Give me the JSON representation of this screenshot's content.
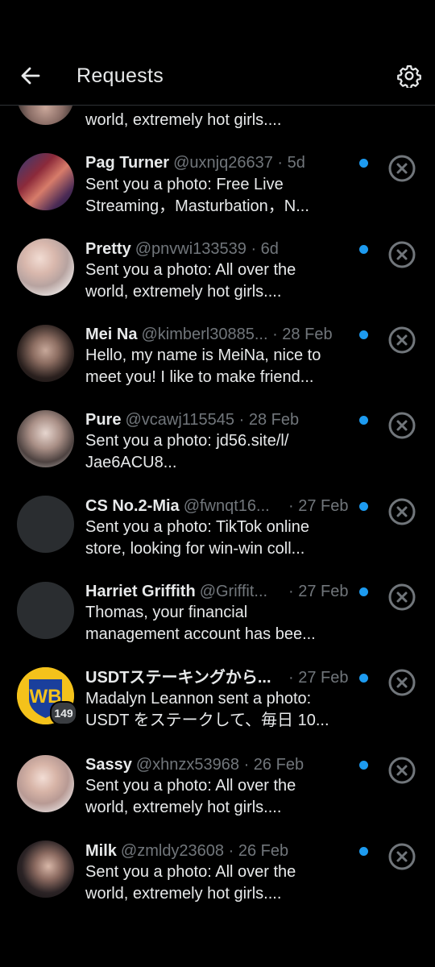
{
  "header": {
    "title": "Requests",
    "back_icon": "arrow-left-icon",
    "settings_icon": "gear-icon"
  },
  "partial_item": {
    "preview": "world, extremely hot girls...."
  },
  "requests": [
    {
      "name": "Pag Turner",
      "handle": "@uxnjq26637",
      "time": "· 5d",
      "preview": "Sent you a photo: Free Live\nStreaming，Masturbation，N...",
      "unread": true
    },
    {
      "name": "Pretty",
      "handle": "@pnvwi133539",
      "time": "· 6d",
      "preview": "Sent you a photo: All over the\nworld, extremely hot girls....",
      "unread": true
    },
    {
      "name": "Mei Na",
      "handle": "@kimberl30885...",
      "time": "· 28 Feb",
      "preview": "Hello, my name is MeiNa, nice to\nmeet you! I like to make friend...",
      "unread": true
    },
    {
      "name": "Pure",
      "handle": "@vcawj115545",
      "time": "· 28 Feb",
      "preview": "Sent you a photo: jd56.site/l/\nJae6ACU8...",
      "unread": true
    },
    {
      "name": "CS No.2-Mia",
      "handle": "@fwnqt16...",
      "time": "· 27 Feb",
      "preview": "Sent you a photo: TikTok online\nstore, looking for win-win coll...",
      "unread": true
    },
    {
      "name": "Harriet Griffith",
      "handle": "@Griffit...",
      "time": "· 27 Feb",
      "preview": "Thomas, your financial\nmanagement account has bee...",
      "unread": true
    },
    {
      "name": "USDTステーキングから...",
      "handle": "",
      "time": "· 27 Feb",
      "preview": "Madalyn Leannon sent a photo:\nUSDT をステークして、毎日 10...",
      "unread": true,
      "badge": "149"
    },
    {
      "name": "Sassy",
      "handle": "@xhnzx53968",
      "time": "· 26 Feb",
      "preview": "Sent you a photo: All over the\nworld, extremely hot girls....",
      "unread": true
    },
    {
      "name": "Milk",
      "handle": "@zmldy23608",
      "time": "· 26 Feb",
      "preview": "Sent you a photo: All over the\nworld, extremely hot girls....",
      "unread": true
    }
  ],
  "colors": {
    "background": "#000000",
    "text": "#e7e9ea",
    "muted": "#71767b",
    "unread_dot": "#1d9bf0",
    "divider": "#2f3336"
  }
}
